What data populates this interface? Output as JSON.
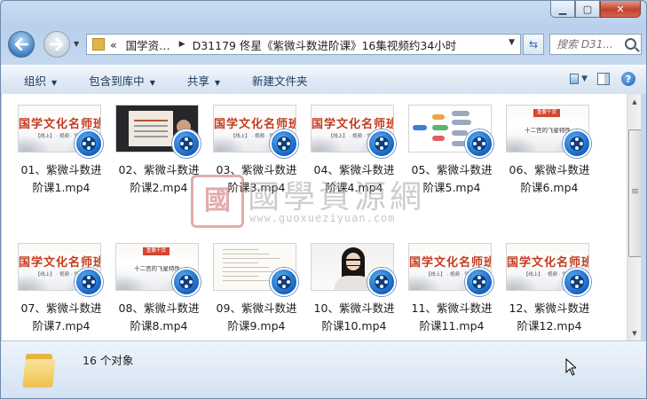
{
  "window": {
    "caption_buttons": [
      "minimize",
      "maximize",
      "close"
    ]
  },
  "nav": {
    "breadcrumb_overflow": "«",
    "breadcrumb": [
      "国学资…",
      "D31179 佟星《紫微斗数进阶课》16集视频约34小时"
    ],
    "search_placeholder": "搜索 D31..."
  },
  "toolbar": {
    "organize": "组织",
    "include_in_library": "包含到库中",
    "share": "共享",
    "new_folder": "新建文件夹"
  },
  "files": [
    {
      "name_line1": "01、紫微斗数进",
      "name_line2": "阶课1.mp4",
      "thumb": "title"
    },
    {
      "name_line1": "02、紫微斗数进",
      "name_line2": "阶课2.mp4",
      "thumb": "lecture"
    },
    {
      "name_line1": "03、紫微斗数进",
      "name_line2": "阶课3.mp4",
      "thumb": "title"
    },
    {
      "name_line1": "04、紫微斗数进",
      "name_line2": "阶课4.mp4",
      "thumb": "title"
    },
    {
      "name_line1": "05、紫微斗数进",
      "name_line2": "阶课5.mp4",
      "thumb": "mindmap"
    },
    {
      "name_line1": "06、紫微斗数进",
      "name_line2": "阶课6.mp4",
      "thumb": "topic"
    },
    {
      "name_line1": "07、紫微斗数进",
      "name_line2": "阶课7.mp4",
      "thumb": "title"
    },
    {
      "name_line1": "08、紫微斗数进",
      "name_line2": "阶课8.mp4",
      "thumb": "topic"
    },
    {
      "name_line1": "09、紫微斗数进",
      "name_line2": "阶课9.mp4",
      "thumb": "paper"
    },
    {
      "name_line1": "10、紫微斗数进",
      "name_line2": "阶课10.mp4",
      "thumb": "presenter"
    },
    {
      "name_line1": "11、紫微斗数进",
      "name_line2": "阶课11.mp4",
      "thumb": "title"
    },
    {
      "name_line1": "12、紫微斗数进",
      "name_line2": "阶课12.mp4",
      "thumb": "title"
    }
  ],
  "thumb_text": {
    "title": "国学文化名师班",
    "title_sub": "【线上】 · 视频 · 学习",
    "tag": "重要干货",
    "topic_line": "十二宫的飞星特性"
  },
  "watermark": {
    "seal": "國",
    "text": "國學資源網",
    "url": "www.guoxueziyuan.com"
  },
  "status": {
    "count": "16 个对象"
  },
  "colors": {
    "accent": "#1463c2",
    "title_red": "#c43a1e"
  }
}
